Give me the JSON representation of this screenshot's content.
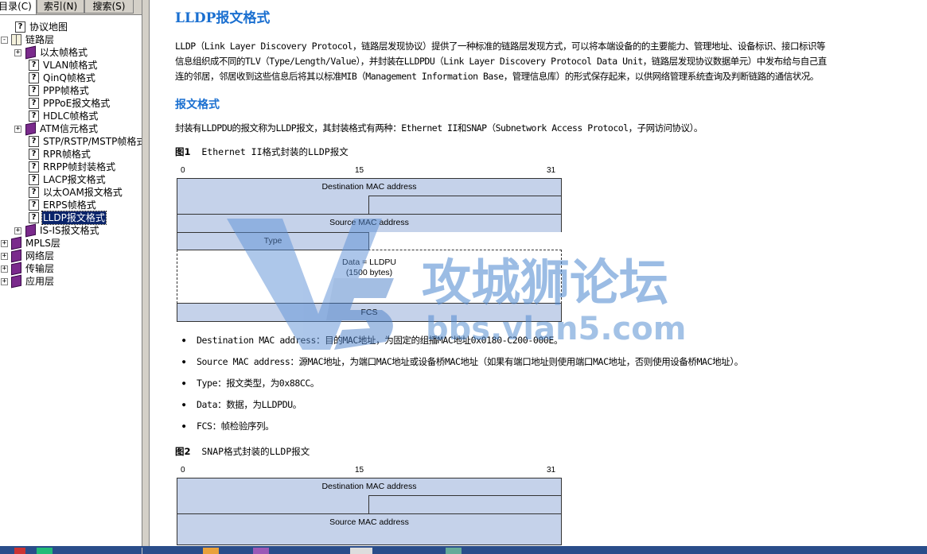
{
  "tabs": [
    "目录(C)",
    "索引(N)",
    "搜索(S)"
  ],
  "tree": [
    {
      "label": "协议地图",
      "icon": "page",
      "level": 0,
      "exp": ""
    },
    {
      "label": "链路层",
      "icon": "openbook",
      "level": 0,
      "exp": "-"
    },
    {
      "label": "以太帧格式",
      "icon": "book",
      "level": 1,
      "exp": "+"
    },
    {
      "label": "VLAN帧格式",
      "icon": "page",
      "level": 2,
      "exp": ""
    },
    {
      "label": "QinQ帧格式",
      "icon": "page",
      "level": 2,
      "exp": ""
    },
    {
      "label": "PPP帧格式",
      "icon": "page",
      "level": 2,
      "exp": ""
    },
    {
      "label": "PPPoE报文格式",
      "icon": "page",
      "level": 2,
      "exp": ""
    },
    {
      "label": "HDLC帧格式",
      "icon": "page",
      "level": 2,
      "exp": ""
    },
    {
      "label": "ATM信元格式",
      "icon": "book",
      "level": 1,
      "exp": "+"
    },
    {
      "label": "STP/RSTP/MSTP帧格式",
      "icon": "page",
      "level": 2,
      "exp": ""
    },
    {
      "label": "RPR帧格式",
      "icon": "page",
      "level": 2,
      "exp": ""
    },
    {
      "label": "RRPP帧封装格式",
      "icon": "page",
      "level": 2,
      "exp": ""
    },
    {
      "label": "LACP报文格式",
      "icon": "page",
      "level": 2,
      "exp": ""
    },
    {
      "label": "以太OAM报文格式",
      "icon": "page",
      "level": 2,
      "exp": ""
    },
    {
      "label": "ERPS帧格式",
      "icon": "page",
      "level": 2,
      "exp": ""
    },
    {
      "label": "LLDP报文格式",
      "icon": "page",
      "level": 2,
      "exp": "",
      "selected": true
    },
    {
      "label": "IS-IS报文格式",
      "icon": "book",
      "level": 1,
      "exp": "+"
    },
    {
      "label": "MPLS层",
      "icon": "book",
      "level": 0,
      "exp": "+"
    },
    {
      "label": "网络层",
      "icon": "book",
      "level": 0,
      "exp": "+"
    },
    {
      "label": "传输层",
      "icon": "book",
      "level": 0,
      "exp": "+"
    },
    {
      "label": "应用层",
      "icon": "book",
      "level": 0,
      "exp": "+"
    }
  ],
  "content": {
    "title": "LLDP报文格式",
    "intro_lines": [
      "LLDP（Link Layer Discovery Protocol，链路层发现协议）提供了一种标准的链路层发现方式，可以将本端设备的的主要能力、管理地址、设备标识、接口标识等",
      "信息组织成不同的TLV（Type/Length/Value），并封装在LLDPDU（Link Layer Discovery Protocol Data Unit，链路层发现协议数据单元）中发布给与自己直",
      "连的邻居，邻居收到这些信息后将其以标准MIB（Management Information Base，管理信息库）的形式保存起来，以供网络管理系统查询及判断链路的通信状况。"
    ],
    "section_title": "报文格式",
    "section_text": "封装有LLDPDU的报文称为LLDP报文，其封装格式有两种：Ethernet II和SNAP（Subnetwork Access Protocol，子网访问协议）。",
    "fig1": {
      "label": "图1",
      "caption": "Ethernet II格式封装的LLDP报文",
      "bits": [
        "0",
        "15",
        "31"
      ],
      "fields": {
        "dst": "Destination MAC address",
        "src": "Source MAC address",
        "type": "Type",
        "data1": "Data = LLDPU",
        "data2": "(1500 bytes)",
        "fcs": "FCS"
      }
    },
    "bullets": [
      "Destination MAC address：目的MAC地址，为固定的组播MAC地址0x0180-C200-000E。",
      "Source MAC address：源MAC地址，为端口MAC地址或设备桥MAC地址（如果有端口地址则使用端口MAC地址，否则使用设备桥MAC地址）。",
      "Type：报文类型，为0x88CC。",
      "Data：数据，为LLDPDU。",
      "FCS：帧检验序列。"
    ],
    "fig2": {
      "label": "图2",
      "caption": "SNAP格式封装的LLDP报文",
      "bits": [
        "0",
        "15",
        "31"
      ],
      "fields": {
        "dst": "Destination MAC address",
        "src": "Source MAC address"
      }
    }
  },
  "watermark": {
    "text": "攻城狮论坛",
    "url": "bbs.vlan5.com",
    "logo": "V5"
  },
  "colors": {
    "link": "#1a6fd0",
    "field_fill": "#c5d2ea",
    "selection": "#0a246a"
  }
}
